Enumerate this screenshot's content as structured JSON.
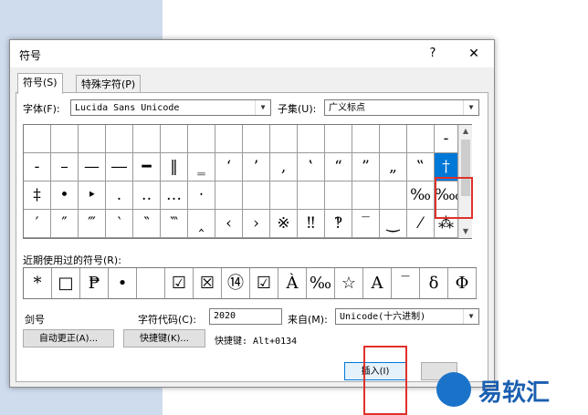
{
  "dialog": {
    "title": "符号",
    "help": "?",
    "close": "✕"
  },
  "tabs": [
    {
      "label": "符号(S)"
    },
    {
      "label": "特殊字符(P)"
    }
  ],
  "font": {
    "label": "字体(F):",
    "value": "Lucida Sans Unicode"
  },
  "subset": {
    "label": "子集(U):",
    "value": "广义标点"
  },
  "grid": {
    "rows": [
      [
        "",
        "",
        "",
        "",
        "",
        "",
        "",
        "",
        "",
        "",
        "",
        "",
        "",
        "",
        "",
        "-"
      ],
      [
        "-",
        "–",
        "—",
        "―",
        "━",
        "‖",
        "‗",
        "‘",
        "’",
        "‚",
        "‛",
        "“",
        "”",
        "„",
        "‟",
        "†"
      ],
      [
        "‡",
        "•",
        "‣",
        "․",
        "‥",
        "…",
        "‧",
        "",
        "",
        "",
        "",
        "",
        "",
        "",
        "‰",
        "‱"
      ],
      [
        "′",
        "″",
        "‴",
        "‵",
        "‶",
        "‷",
        "‸",
        "‹",
        "›",
        "※",
        "‼",
        "‽",
        "‾",
        "‿",
        "⁄",
        "⁂"
      ]
    ],
    "selected": {
      "row": 1,
      "col": 15
    }
  },
  "recent": {
    "label": "近期使用过的符号(R):",
    "symbols": [
      "*",
      "□",
      "₱",
      "•",
      "",
      "☑",
      "☒",
      "⑭",
      "☑",
      "À",
      "‰",
      "☆",
      "A",
      "‾",
      "δ",
      "Φ"
    ]
  },
  "char_name": "剑号",
  "code": {
    "label": "字符代码(C):",
    "value": "2020"
  },
  "from": {
    "label": "来自(M):",
    "value": "Unicode(十六进制)"
  },
  "buttons": {
    "autocorrect": "自动更正(A)...",
    "shortcut_key": "快捷键(K)...",
    "insert": "插入(I)"
  },
  "shortcut": {
    "text": "快捷键: Alt+0134"
  },
  "watermark": {
    "text": "易软汇"
  },
  "colors": {
    "selection": "#0078d7",
    "highlight": "#e0302a",
    "logo": "#1a73c9"
  }
}
